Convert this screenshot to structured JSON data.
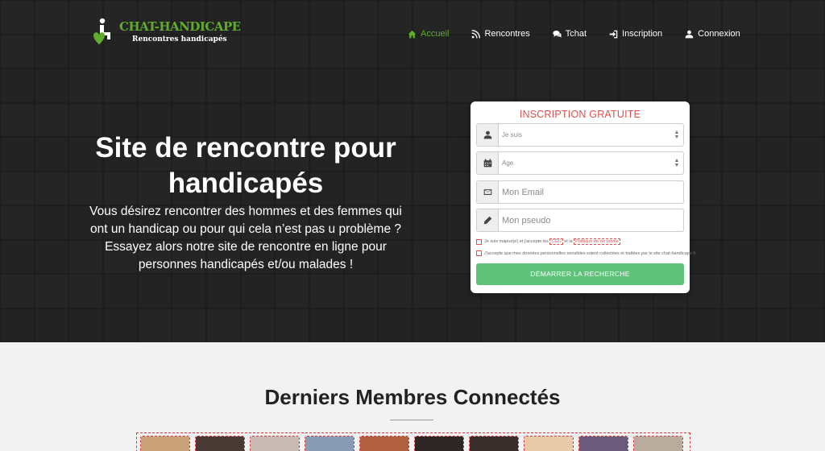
{
  "brand": {
    "name": "CHAT-HANDICAPE",
    "tagline": "Rencontres handicapés"
  },
  "nav": [
    {
      "label": "Accueil",
      "icon": "home-icon",
      "active": true
    },
    {
      "label": "Rencontres",
      "icon": "rss-icon",
      "active": false
    },
    {
      "label": "Tchat",
      "icon": "comments-icon",
      "active": false
    },
    {
      "label": "Inscription",
      "icon": "sign-in-icon",
      "active": false
    },
    {
      "label": "Connexion",
      "icon": "user-icon",
      "active": false
    }
  ],
  "hero": {
    "title": "Site de rencontre pour handicapés",
    "description": "Vous désirez rencontrer des hommes et des femmes qui ont un handicap ou pour qui cela n’est pas u problème ? Essayez alors notre site de rencontre en ligne pour personnes handicapés et/ou malades !"
  },
  "form": {
    "title": "INSCRIPTION GRATUITE",
    "gender_select": "Je suis",
    "age_select": "Age",
    "email_placeholder": "Mon Email",
    "pseudo_placeholder": "Mon pseudo",
    "consent_1_prefix": "Je suis majeur(e) et j'accepte les",
    "consent_1_cgu": "CGU",
    "consent_1_mid": "et la",
    "consent_1_privacy": "Politique de vie privée",
    "consent_2": "J'accepte que mes données personnelles sensibles soient collectées et traitées par le site chat-handicape.fr",
    "submit": "DÉMARRER LA RECHERCHE"
  },
  "members": {
    "title": "Derniers Membres Connectés",
    "thumb_colors": [
      "#c9a27a",
      "#4a3a36",
      "#c7b9b4",
      "#8a9bb5",
      "#b0603f",
      "#2e2624",
      "#3a2f2c",
      "#e8c9a8",
      "#6b5a7a",
      "#b9ab9e"
    ]
  },
  "colors": {
    "accent_green": "#5fae2b",
    "form_title_red": "#e1504a",
    "button_green": "#5ec27a"
  }
}
